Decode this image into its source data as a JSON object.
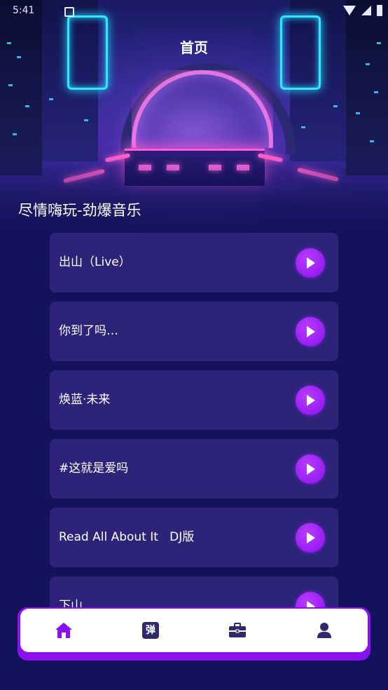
{
  "status_bar": {
    "time": "5:41"
  },
  "header": {
    "title": "首页"
  },
  "section": {
    "title": "尽情嗨玩-劲爆音乐"
  },
  "songs": [
    {
      "title": "出山（Live）"
    },
    {
      "title": "你到了吗…"
    },
    {
      "title": "焕蓝·未来"
    },
    {
      "title": "#这就是爱吗"
    },
    {
      "title": "Read All About It   DJ版"
    },
    {
      "title": "下山"
    }
  ],
  "tabbar": {
    "tabs": [
      {
        "icon": "home-icon",
        "active": true
      },
      {
        "icon": "danmu-icon",
        "glyph": "弹"
      },
      {
        "icon": "briefcase-icon"
      },
      {
        "icon": "user-icon"
      }
    ]
  },
  "colors": {
    "background": "#13125a",
    "card": "#2d2479",
    "accent": "#8a10ef",
    "tab_icon": "#2f2a6e"
  }
}
